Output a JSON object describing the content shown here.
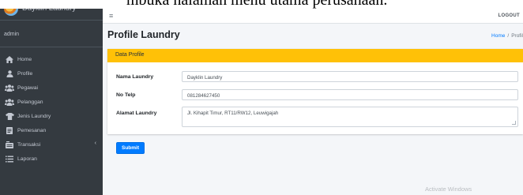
{
  "caption": "mbuka halaman menu utama perusahaan.",
  "brand": {
    "name": "Dayklin Laundry",
    "logo": "laundry-logo"
  },
  "user": {
    "name": "admin"
  },
  "nav": {
    "items": [
      {
        "label": "Home",
        "icon": "home-icon"
      },
      {
        "label": "Profile",
        "icon": "user-icon"
      },
      {
        "label": "Pegawai",
        "icon": "users-icon"
      },
      {
        "label": "Pelanggan",
        "icon": "users-icon"
      },
      {
        "label": "Jenis Laundry",
        "icon": "shirt-icon"
      },
      {
        "label": "Pemesanan",
        "icon": "document-icon"
      },
      {
        "label": "Transaksi",
        "icon": "transaction-icon",
        "arrow": "‹"
      },
      {
        "label": "Laporan",
        "icon": "list-icon"
      }
    ]
  },
  "topnav": {
    "menu_icon": "≡",
    "logout": "LOGOUT"
  },
  "page": {
    "title": "Profile Laundry",
    "breadcrumb": {
      "home": "Home",
      "separator": "/",
      "current": "Profil"
    }
  },
  "card": {
    "header": "Data Profile",
    "header_color": "#ffc107"
  },
  "form": {
    "nama_label": "Nama Laundry",
    "nama_value": "Dayklin Laundry",
    "telp_label": "No Telp",
    "telp_value": "081284627450",
    "alamat_label": "Alamat Laundry",
    "alamat_value": "Jl. Kihapit Timur, RT11/RW12, Leuwigajah",
    "submit": "Submit"
  },
  "watermark": "Activate Windows",
  "colors": {
    "sidebar": "#343a40",
    "accent": "#007bff",
    "header": "#ffc107"
  }
}
